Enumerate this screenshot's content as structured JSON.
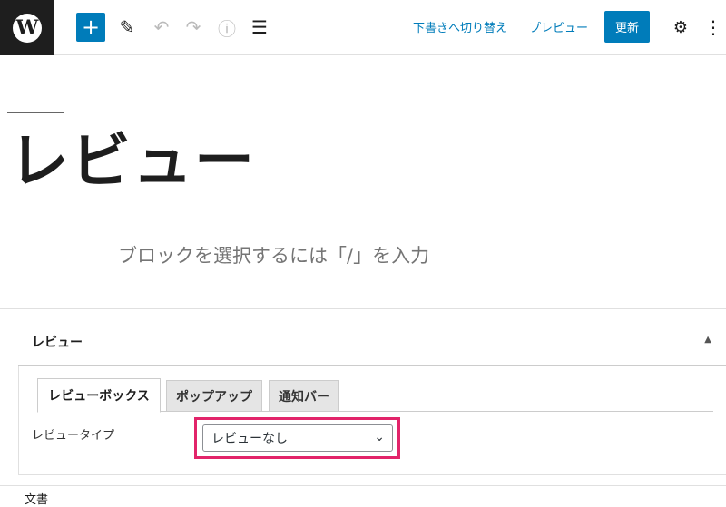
{
  "toolbar": {
    "logo_letter": "W",
    "add_icon": "plus-icon",
    "add_glyph": "+",
    "tools_glyph": "✎",
    "undo_glyph": "↶",
    "redo_glyph": "↷",
    "info_glyph": "ⓘ",
    "outline_glyph": "☰",
    "save_draft_label": "下書きへ切り替え",
    "preview_label": "プレビュー",
    "update_label": "更新",
    "settings_glyph": "⚙",
    "more_glyph": "⋮",
    "accent_color": "#007cba"
  },
  "editor": {
    "post_title": "レビュー",
    "block_placeholder": "ブロックを選択するには「/」を入力"
  },
  "metabox": {
    "title": "レビュー",
    "toggle_glyph": "▲",
    "tabs": [
      {
        "label": "レビューボックス",
        "active": true
      },
      {
        "label": "ポップアップ",
        "active": false
      },
      {
        "label": "通知バー",
        "active": false
      }
    ],
    "review_type_label": "レビュータイプ",
    "review_type_value": "レビューなし",
    "select_chevron": "⌄",
    "highlight_color": "#e2246a"
  },
  "footer": {
    "breadcrumb": "文書"
  }
}
